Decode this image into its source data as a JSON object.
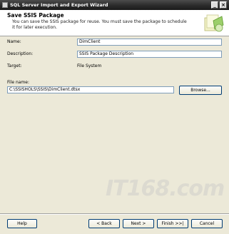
{
  "window": {
    "title": "SQL Server Import and Export Wizard"
  },
  "header": {
    "title": "Save SSIS Package",
    "description": "You can save the SSIS package for reuse. You must save the package to schedule it for later execution."
  },
  "form": {
    "name_label": "Name:",
    "name_value": "DimClient",
    "description_label": "Description:",
    "description_value": "SSIS Package Description",
    "target_label": "Target:",
    "target_value": "File System",
    "file_name_label": "File name:",
    "file_name_value": "C:\\SSISHOLS\\SSIS\\DimClient.dtsx",
    "browse_label": "Browse..."
  },
  "footer": {
    "help_label": "Help",
    "back_label": "< Back",
    "next_label": "Next >",
    "finish_label": "Finish >>|",
    "cancel_label": "Cancel"
  },
  "watermark": {
    "text": "IT168.com"
  },
  "icons": {
    "app": "wizard-app-icon",
    "minimize": "minimize-icon",
    "close": "close-icon",
    "header_art": "package-art-icon"
  }
}
